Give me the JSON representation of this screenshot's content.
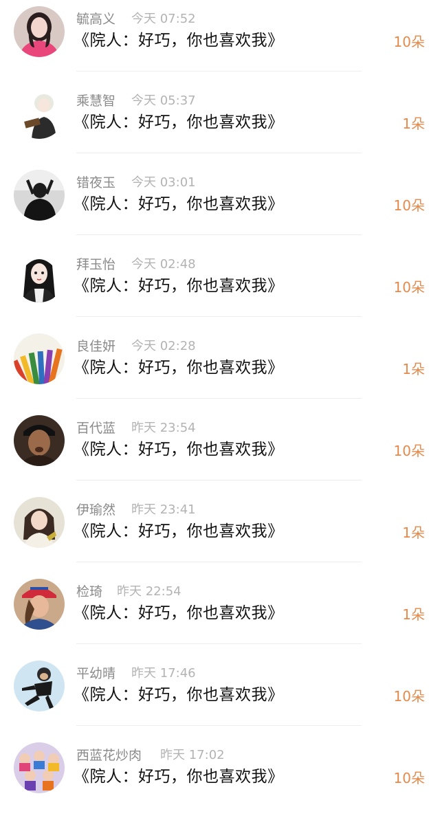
{
  "colors": {
    "name": "#8a8a8a",
    "time": "#b3b3b3",
    "message": "#111111",
    "gift": "#e58a4b",
    "divider": "#ededed"
  },
  "items": [
    {
      "name": "毓高义",
      "time": "今天 07:52",
      "message": "《院人：好巧，你也喜欢我》",
      "gift": "10朵",
      "avatar": "avatar-girl-pink"
    },
    {
      "name": "乘慧智",
      "time": "今天 05:37",
      "message": "《院人：好巧，你也喜欢我》",
      "gift": "1朵",
      "avatar": "avatar-anime-boy"
    },
    {
      "name": "错夜玉",
      "time": "今天 03:01",
      "message": "《院人：好巧，你也喜欢我》",
      "gift": "10朵",
      "avatar": "avatar-person-dark"
    },
    {
      "name": "拜玉怡",
      "time": "今天 02:48",
      "message": "《院人：好巧，你也喜欢我》",
      "gift": "10朵",
      "avatar": "avatar-anime-girl"
    },
    {
      "name": "良佳妍",
      "time": "今天 02:28",
      "message": "《院人：好巧，你也喜欢我》",
      "gift": "1朵",
      "avatar": "avatar-pencils"
    },
    {
      "name": "百代蓝",
      "time": "昨天 23:54",
      "message": "《院人：好巧，你也喜欢我》",
      "gift": "10朵",
      "avatar": "avatar-man-cap"
    },
    {
      "name": "伊瑜然",
      "time": "昨天 23:41",
      "message": "《院人：好巧，你也喜欢我》",
      "gift": "1朵",
      "avatar": "avatar-girl-photo"
    },
    {
      "name": "检琦",
      "time": "昨天 22:54",
      "message": "《院人：好巧，你也喜欢我》",
      "gift": "1朵",
      "avatar": "avatar-woman-red-cap"
    },
    {
      "name": "平幼晴",
      "time": "昨天 17:46",
      "message": "《院人：好巧，你也喜欢我》",
      "gift": "10朵",
      "avatar": "avatar-monkey"
    },
    {
      "name": "西蓝花炒肉",
      "time": "昨天 17:02",
      "message": "《院人：好巧，你也喜欢我》",
      "gift": "10朵",
      "avatar": "avatar-cartoon-group"
    }
  ]
}
